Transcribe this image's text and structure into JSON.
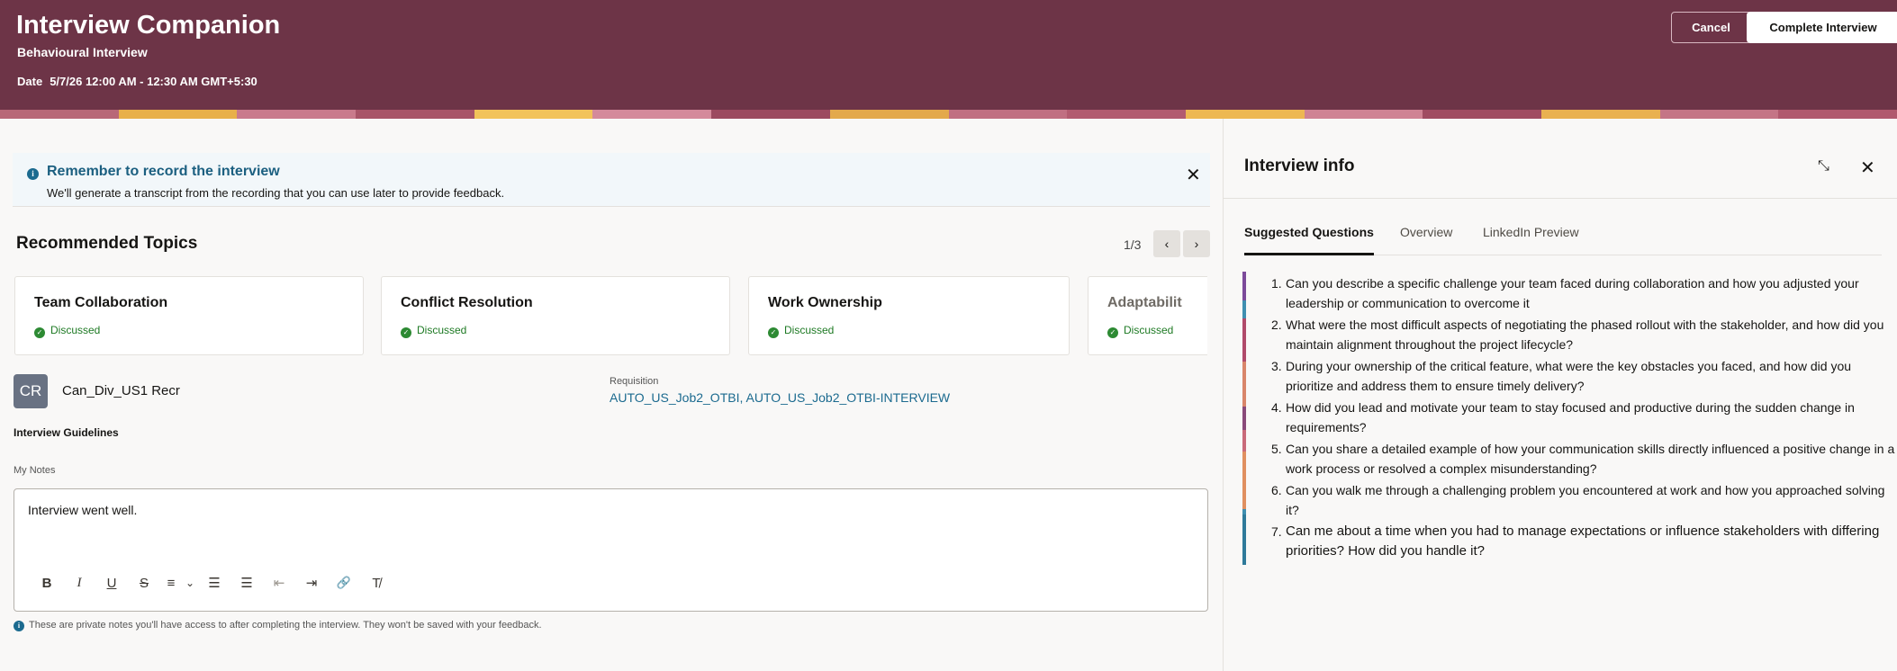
{
  "header": {
    "title": "Interview Companion",
    "subtitle": "Behavioural Interview",
    "date_label": "Date",
    "date_value": "5/7/26 12:00 AM - 12:30 AM GMT+5:30",
    "cancel_label": "Cancel",
    "complete_label": "Complete Interview",
    "bg_color": "#6d3447"
  },
  "banner": {
    "title": "Remember to record the interview",
    "text": "We'll generate a transcript from the recording that you can use later to provide feedback.",
    "info_glyph": "i",
    "close_glyph": "✕"
  },
  "recommended": {
    "title": "Recommended Topics",
    "pager": "1/3",
    "prev_glyph": "‹",
    "next_glyph": "›",
    "topics": [
      {
        "title": "Team Collaboration",
        "status": "Discussed"
      },
      {
        "title": "Conflict Resolution",
        "status": "Discussed"
      },
      {
        "title": "Work Ownership",
        "status": "Discussed"
      },
      {
        "title": "Adaptabilit",
        "status": "Discussed"
      }
    ]
  },
  "candidate": {
    "initials": "CR",
    "name": "Can_Div_US1 Recr",
    "requisition_label": "Requisition",
    "requisition_value": "AUTO_US_Job2_OTBI, AUTO_US_Job2_OTBI-INTERVIEW"
  },
  "guidelines_label": "Interview Guidelines",
  "notes": {
    "label": "My Notes",
    "value": "Interview went well.",
    "hint": "These are private notes you'll have access to after completing the interview. They won't be saved with your feedback.",
    "toolbar": {
      "bold": "B",
      "italic": "I",
      "underline": "U",
      "strike": "S",
      "align": "≡",
      "chevron": "⌄",
      "bullets": "☰",
      "numbered": "☰",
      "outdent": "⇤",
      "indent": "⇥",
      "link": "🔗",
      "clear": "T̸"
    }
  },
  "info_panel": {
    "title": "Interview info",
    "collapse_glyph": "⤡",
    "close_glyph": "✕",
    "tabs": [
      {
        "label": "Suggested Questions"
      },
      {
        "label": "Overview"
      },
      {
        "label": "LinkedIn Preview"
      }
    ],
    "questions": [
      {
        "num": "1.",
        "text": "Can you describe a specific challenge your team faced during collaboration and how you adjusted your leadership or communication to overcome it"
      },
      {
        "num": "2.",
        "text": "What were the most difficult aspects of negotiating the phased rollout with the stakeholder, and how did you maintain alignment throughout the project lifecycle?"
      },
      {
        "num": "3.",
        "text": "During your ownership of the critical feature, what were the key obstacles you faced, and how did you prioritize and address them to ensure timely delivery?"
      },
      {
        "num": "4.",
        "text": "How did you lead and motivate your team to stay focused and productive during the sudden change in requirements?"
      },
      {
        "num": "5.",
        "text": "Can you share a detailed example of how your communication skills directly influenced a positive change in a work process or resolved a complex misunderstanding?"
      },
      {
        "num": "6.",
        "text": "Can you walk me through a challenging problem you encountered at work and how you approached solving it?"
      },
      {
        "num": "7.",
        "text": "Can me about a time when you had to manage expectations or influence stakeholders with differing priorities? How did you handle it?"
      }
    ]
  }
}
